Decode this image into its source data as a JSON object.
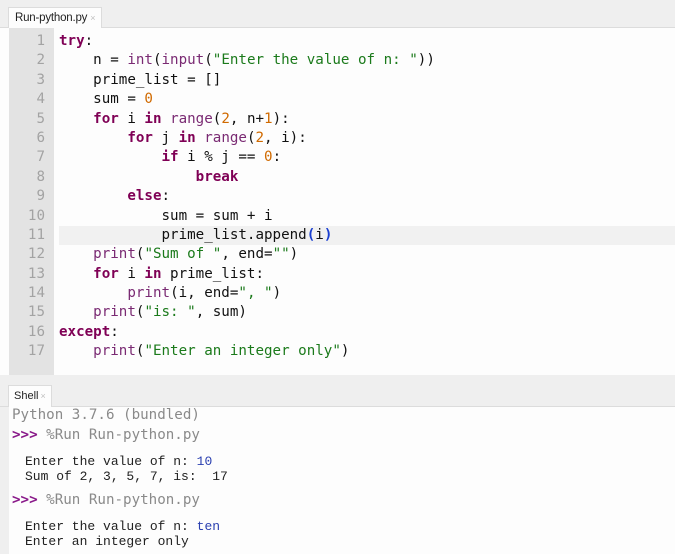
{
  "editor": {
    "tab": {
      "label": "Run-python.py",
      "close_glyph": "×"
    },
    "current_line": 11,
    "lines": [
      {
        "num": "1",
        "segments": [
          {
            "t": "kw",
            "v": "try"
          },
          {
            "t": "",
            "v": ":"
          }
        ]
      },
      {
        "num": "2",
        "segments": [
          {
            "t": "",
            "v": "    n = "
          },
          {
            "t": "bi",
            "v": "int"
          },
          {
            "t": "",
            "v": "("
          },
          {
            "t": "bi",
            "v": "input"
          },
          {
            "t": "",
            "v": "("
          },
          {
            "t": "st",
            "v": "\"Enter the value of n: \""
          },
          {
            "t": "",
            "v": "))"
          }
        ]
      },
      {
        "num": "3",
        "segments": [
          {
            "t": "",
            "v": "    prime_list = []"
          }
        ]
      },
      {
        "num": "4",
        "segments": [
          {
            "t": "",
            "v": "    sum = "
          },
          {
            "t": "nm",
            "v": "0"
          }
        ]
      },
      {
        "num": "5",
        "segments": [
          {
            "t": "",
            "v": "    "
          },
          {
            "t": "kw",
            "v": "for"
          },
          {
            "t": "",
            "v": " i "
          },
          {
            "t": "kw",
            "v": "in"
          },
          {
            "t": "",
            "v": " "
          },
          {
            "t": "bi",
            "v": "range"
          },
          {
            "t": "",
            "v": "("
          },
          {
            "t": "nm",
            "v": "2"
          },
          {
            "t": "",
            "v": ", n+"
          },
          {
            "t": "nm",
            "v": "1"
          },
          {
            "t": "",
            "v": "):"
          }
        ]
      },
      {
        "num": "6",
        "segments": [
          {
            "t": "",
            "v": "        "
          },
          {
            "t": "kw",
            "v": "for"
          },
          {
            "t": "",
            "v": " j "
          },
          {
            "t": "kw",
            "v": "in"
          },
          {
            "t": "",
            "v": " "
          },
          {
            "t": "bi",
            "v": "range"
          },
          {
            "t": "",
            "v": "("
          },
          {
            "t": "nm",
            "v": "2"
          },
          {
            "t": "",
            "v": ", i):"
          }
        ]
      },
      {
        "num": "7",
        "segments": [
          {
            "t": "",
            "v": "            "
          },
          {
            "t": "kw",
            "v": "if"
          },
          {
            "t": "",
            "v": " i % j == "
          },
          {
            "t": "nm",
            "v": "0"
          },
          {
            "t": "",
            "v": ":"
          }
        ]
      },
      {
        "num": "8",
        "segments": [
          {
            "t": "",
            "v": "                "
          },
          {
            "t": "kw",
            "v": "break"
          }
        ]
      },
      {
        "num": "9",
        "segments": [
          {
            "t": "",
            "v": "        "
          },
          {
            "t": "kw",
            "v": "else"
          },
          {
            "t": "",
            "v": ":"
          }
        ]
      },
      {
        "num": "10",
        "segments": [
          {
            "t": "",
            "v": "            sum = sum + i"
          }
        ]
      },
      {
        "num": "11",
        "segments": [
          {
            "t": "",
            "v": "            prime_list.append"
          },
          {
            "t": "br",
            "v": "("
          },
          {
            "t": "",
            "v": "i"
          },
          {
            "t": "br",
            "v": ")"
          }
        ]
      },
      {
        "num": "12",
        "segments": [
          {
            "t": "",
            "v": "    "
          },
          {
            "t": "bi",
            "v": "print"
          },
          {
            "t": "",
            "v": "("
          },
          {
            "t": "st",
            "v": "\"Sum of \""
          },
          {
            "t": "",
            "v": ", end="
          },
          {
            "t": "st",
            "v": "\"\""
          },
          {
            "t": "",
            "v": ")"
          }
        ]
      },
      {
        "num": "13",
        "segments": [
          {
            "t": "",
            "v": "    "
          },
          {
            "t": "kw",
            "v": "for"
          },
          {
            "t": "",
            "v": " i "
          },
          {
            "t": "kw",
            "v": "in"
          },
          {
            "t": "",
            "v": " prime_list:"
          }
        ]
      },
      {
        "num": "14",
        "segments": [
          {
            "t": "",
            "v": "        "
          },
          {
            "t": "bi",
            "v": "print"
          },
          {
            "t": "",
            "v": "(i, end="
          },
          {
            "t": "st",
            "v": "\", \""
          },
          {
            "t": "",
            "v": ")"
          }
        ]
      },
      {
        "num": "15",
        "segments": [
          {
            "t": "",
            "v": "    "
          },
          {
            "t": "bi",
            "v": "print"
          },
          {
            "t": "",
            "v": "("
          },
          {
            "t": "st",
            "v": "\"is: \""
          },
          {
            "t": "",
            "v": ", sum)"
          }
        ]
      },
      {
        "num": "16",
        "segments": [
          {
            "t": "kw",
            "v": "except"
          },
          {
            "t": "",
            "v": ":"
          }
        ]
      },
      {
        "num": "17",
        "segments": [
          {
            "t": "",
            "v": "    "
          },
          {
            "t": "bi",
            "v": "print"
          },
          {
            "t": "",
            "v": "("
          },
          {
            "t": "st",
            "v": "\"Enter an integer only\""
          },
          {
            "t": "",
            "v": ")"
          }
        ]
      }
    ]
  },
  "shell": {
    "tab": {
      "label": "Shell",
      "close_glyph": "×"
    },
    "header": "Python 3.7.6 (bundled)",
    "prompt": ">>>",
    "run1": {
      "command": " %Run Run-python.py",
      "input_prompt": "Enter the value of n: ",
      "input_value": "10",
      "output": "Sum of 2, 3, 5, 7, is:  17"
    },
    "run2": {
      "command": " %Run Run-python.py",
      "input_prompt": "Enter the value of n: ",
      "input_value": "ten",
      "output": "Enter an integer only"
    }
  }
}
